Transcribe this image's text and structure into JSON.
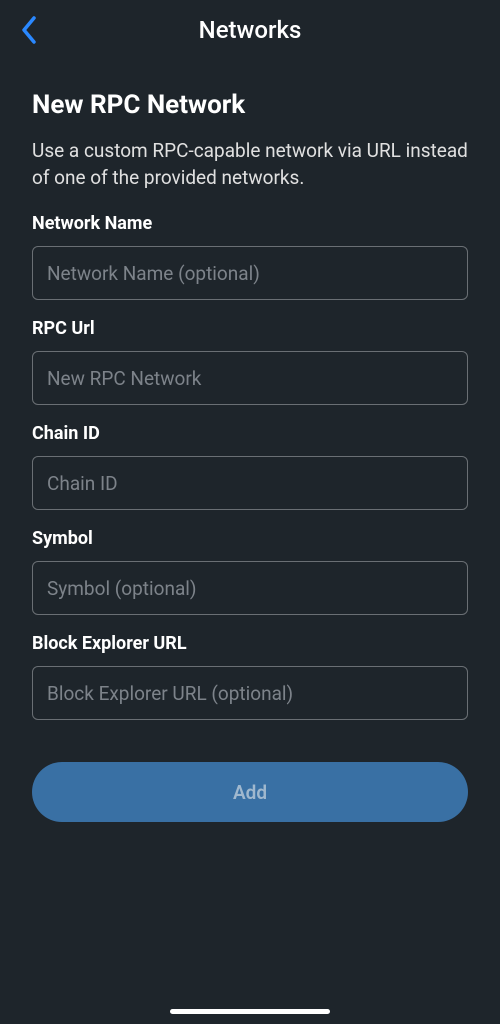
{
  "header": {
    "title": "Networks"
  },
  "page": {
    "title": "New RPC Network",
    "description": "Use a custom RPC-capable network via URL instead of one of the provided networks."
  },
  "fields": {
    "networkName": {
      "label": "Network Name",
      "placeholder": "Network Name (optional)"
    },
    "rpcUrl": {
      "label": "RPC Url",
      "placeholder": "New RPC Network"
    },
    "chainId": {
      "label": "Chain ID",
      "placeholder": "Chain ID"
    },
    "symbol": {
      "label": "Symbol",
      "placeholder": "Symbol (optional)"
    },
    "blockExplorer": {
      "label": "Block Explorer URL",
      "placeholder": "Block Explorer URL (optional)"
    }
  },
  "actions": {
    "add": "Add"
  }
}
